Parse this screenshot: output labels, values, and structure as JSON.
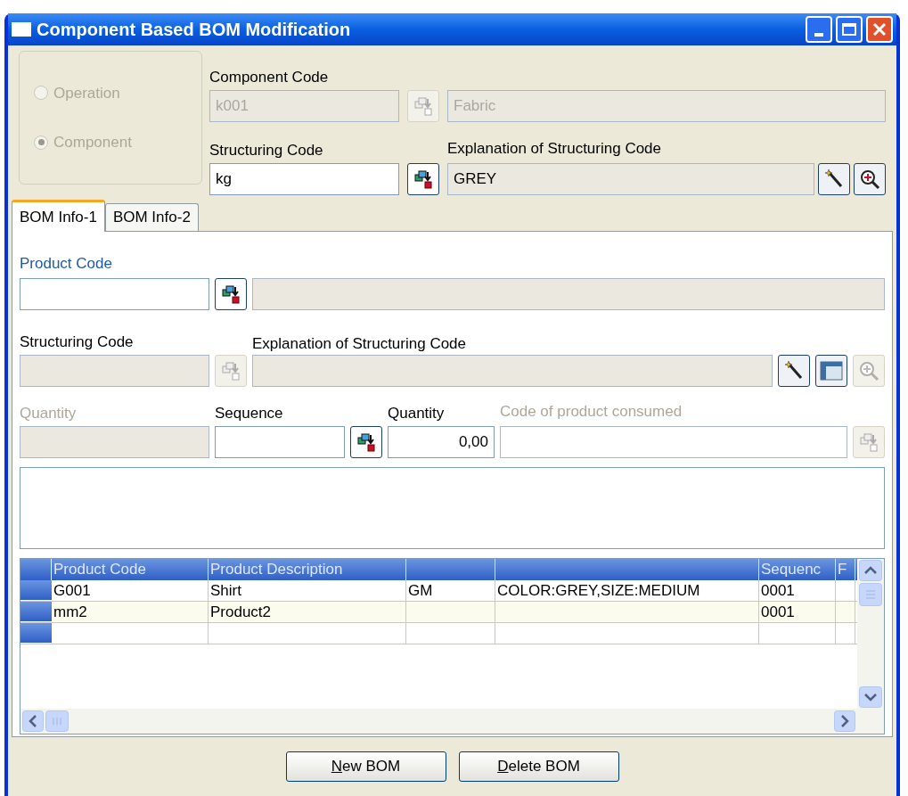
{
  "window": {
    "title": "Component Based BOM Modification"
  },
  "mode": [
    {
      "label": "Operation",
      "selected": false,
      "disabled": true
    },
    {
      "label": "Component",
      "selected": true,
      "disabled": true
    }
  ],
  "component_code": {
    "label": "Component Code",
    "value": "k001",
    "description": "Fabric",
    "disabled": true,
    "lookup_disabled": true
  },
  "structuring_code": {
    "label": "Structuring Code",
    "value": "kg",
    "disabled": false,
    "lookup_disabled": false
  },
  "structuring_explanation": {
    "label": "Explanation of Structuring Code",
    "value": "GREY",
    "tools": [
      {
        "kind": "wand",
        "disabled": false
      },
      {
        "kind": "zoom",
        "disabled": false
      }
    ]
  },
  "tabs": [
    {
      "label": "BOM Info-1",
      "selected": true
    },
    {
      "label": "BOM Info-2",
      "selected": false
    }
  ],
  "product_code": {
    "label": "Product Code",
    "lookup_disabled": false
  },
  "line_structuring_code": {
    "label": "Structuring Code",
    "disabled": true,
    "lookup_disabled": true
  },
  "line_explanation": {
    "label": "Explanation of Structuring Code",
    "tools": [
      {
        "kind": "wand",
        "disabled": false
      },
      {
        "kind": "table",
        "disabled": false
      },
      {
        "kind": "zoom",
        "disabled": true
      }
    ]
  },
  "quantity_left": {
    "label": "Quantity",
    "disabled": true
  },
  "sequence": {
    "label": "Sequence",
    "disabled": false,
    "lookup_disabled": false
  },
  "quantity": {
    "label": "Quantity",
    "value": "0,00",
    "disabled": false
  },
  "consumed": {
    "label": "Code of product consumed",
    "disabled": true,
    "lookup_disabled": true
  },
  "table": {
    "columns": [
      {
        "label": "Product Code"
      },
      {
        "label": "Product Description"
      },
      {},
      {},
      {
        "label": "Sequenc"
      },
      {
        "label": "F"
      }
    ],
    "rows": [
      [
        "G001",
        "Shirt",
        "GM",
        "COLOR:GREY,SIZE:MEDIUM",
        "0001",
        null
      ],
      [
        "mm2",
        "Product2",
        null,
        null,
        "0001",
        null
      ]
    ]
  },
  "buttons": [
    {
      "accesskey": "N",
      "rest": "ew BOM"
    },
    {
      "accesskey": "D",
      "rest": "elete BOM"
    }
  ]
}
